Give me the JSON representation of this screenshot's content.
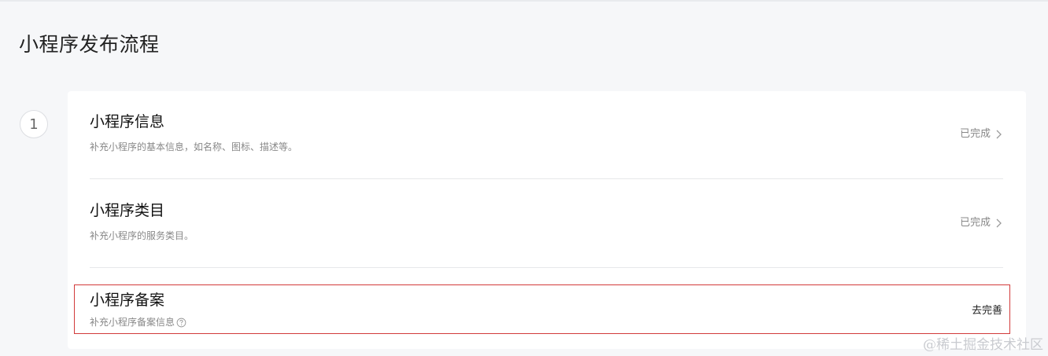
{
  "page": {
    "title": "小程序发布流程"
  },
  "step": {
    "number": "1"
  },
  "items": [
    {
      "title": "小程序信息",
      "desc": "补充小程序的基本信息，如名称、图标、描述等。",
      "status": "已完成"
    },
    {
      "title": "小程序类目",
      "desc": "补充小程序的服务类目。",
      "status": "已完成"
    },
    {
      "title": "小程序备案",
      "desc": "补充小程序备案信息",
      "action": "去完善"
    }
  ],
  "watermark": "@稀土掘金技术社区",
  "colors": {
    "page_bg": "#f6f7f9",
    "card_bg": "#ffffff",
    "highlight_border": "#d23a3a",
    "muted_text": "#888888"
  },
  "icons": {
    "chevron": "chevron-right-icon",
    "help": "question-circle-icon"
  }
}
